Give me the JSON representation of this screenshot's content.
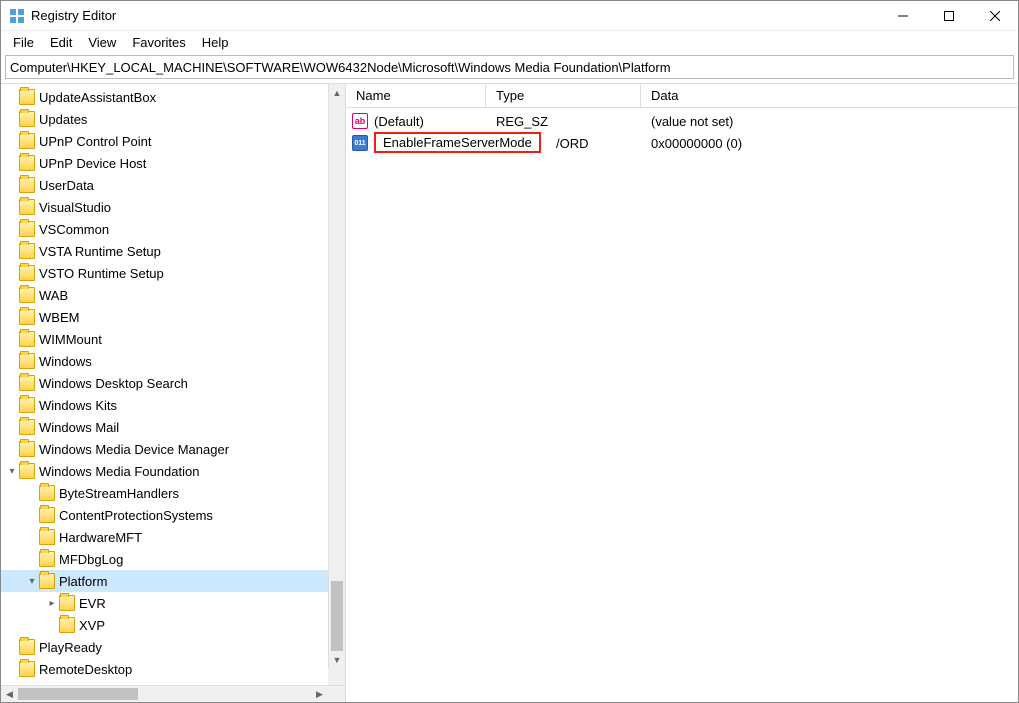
{
  "window": {
    "title": "Registry Editor"
  },
  "menu": {
    "items": [
      "File",
      "Edit",
      "View",
      "Favorites",
      "Help"
    ]
  },
  "address": "Computer\\HKEY_LOCAL_MACHINE\\SOFTWARE\\WOW6432Node\\Microsoft\\Windows Media Foundation\\Platform",
  "tree": {
    "items": [
      {
        "label": "UpdateAssistantBox",
        "level": 0,
        "selected": false,
        "expandable": false
      },
      {
        "label": "Updates",
        "level": 0,
        "selected": false,
        "expandable": false
      },
      {
        "label": "UPnP Control Point",
        "level": 0,
        "selected": false,
        "expandable": false
      },
      {
        "label": "UPnP Device Host",
        "level": 0,
        "selected": false,
        "expandable": false
      },
      {
        "label": "UserData",
        "level": 0,
        "selected": false,
        "expandable": false
      },
      {
        "label": "VisualStudio",
        "level": 0,
        "selected": false,
        "expandable": false
      },
      {
        "label": "VSCommon",
        "level": 0,
        "selected": false,
        "expandable": false
      },
      {
        "label": "VSTA Runtime Setup",
        "level": 0,
        "selected": false,
        "expandable": false
      },
      {
        "label": "VSTO Runtime Setup",
        "level": 0,
        "selected": false,
        "expandable": false
      },
      {
        "label": "WAB",
        "level": 0,
        "selected": false,
        "expandable": false
      },
      {
        "label": "WBEM",
        "level": 0,
        "selected": false,
        "expandable": false
      },
      {
        "label": "WIMMount",
        "level": 0,
        "selected": false,
        "expandable": false
      },
      {
        "label": "Windows",
        "level": 0,
        "selected": false,
        "expandable": false
      },
      {
        "label": "Windows Desktop Search",
        "level": 0,
        "selected": false,
        "expandable": false
      },
      {
        "label": "Windows Kits",
        "level": 0,
        "selected": false,
        "expandable": false
      },
      {
        "label": "Windows Mail",
        "level": 0,
        "selected": false,
        "expandable": false
      },
      {
        "label": "Windows Media Device Manager",
        "level": 0,
        "selected": false,
        "expandable": false
      },
      {
        "label": "Windows Media Foundation",
        "level": 0,
        "selected": false,
        "expandable": true,
        "expanded": true
      },
      {
        "label": "ByteStreamHandlers",
        "level": 1,
        "selected": false,
        "expandable": false
      },
      {
        "label": "ContentProtectionSystems",
        "level": 1,
        "selected": false,
        "expandable": false
      },
      {
        "label": "HardwareMFT",
        "level": 1,
        "selected": false,
        "expandable": false
      },
      {
        "label": "MFDbgLog",
        "level": 1,
        "selected": false,
        "expandable": false
      },
      {
        "label": "Platform",
        "level": 1,
        "selected": true,
        "expandable": true,
        "expanded": true
      },
      {
        "label": "EVR",
        "level": 2,
        "selected": false,
        "expandable": true,
        "expanded": false
      },
      {
        "label": "XVP",
        "level": 2,
        "selected": false,
        "expandable": false
      },
      {
        "label": "PlayReady",
        "level": 0,
        "selected": false,
        "expandable": false
      },
      {
        "label": "RemoteDesktop",
        "level": 0,
        "selected": false,
        "expandable": false
      }
    ]
  },
  "values": {
    "columns": {
      "name": "Name",
      "type": "Type",
      "data": "Data"
    },
    "rows": [
      {
        "icon": "sz",
        "name": "(Default)",
        "type": "REG_SZ",
        "data": "(value not set)",
        "editing": false
      },
      {
        "icon": "dw",
        "name": "EnableFrameServerMode",
        "type": "/ORD",
        "data": "0x00000000 (0)",
        "editing": true
      }
    ]
  }
}
